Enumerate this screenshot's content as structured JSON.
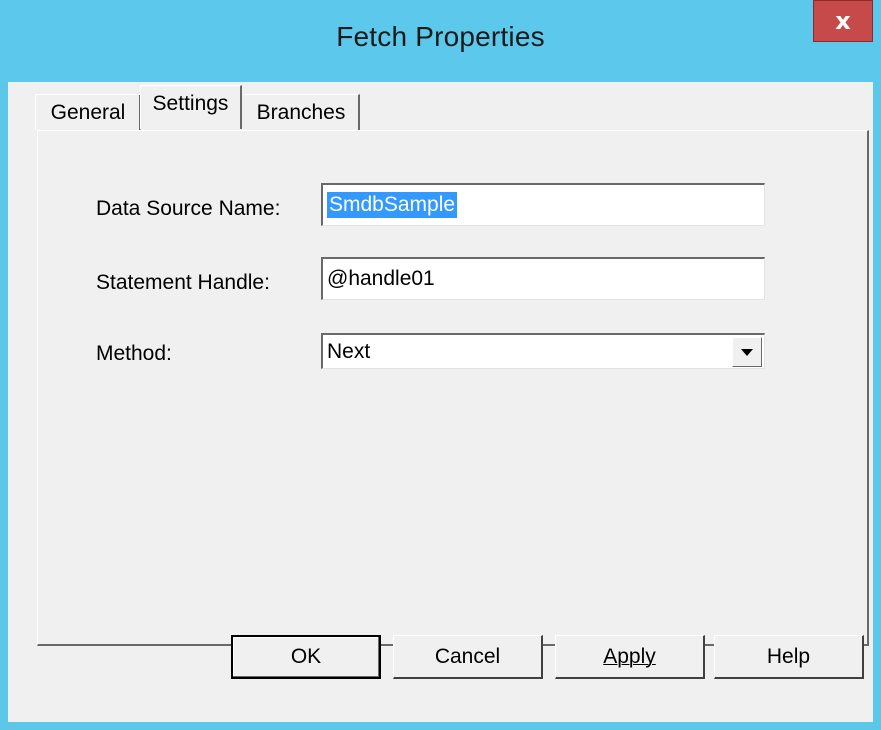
{
  "window": {
    "title": "Fetch Properties",
    "close_label": "x"
  },
  "tabs": [
    {
      "label": "General",
      "active": false
    },
    {
      "label": "Settings",
      "active": true
    },
    {
      "label": "Branches",
      "active": false
    }
  ],
  "form": {
    "data_source_label": "Data Source Name:",
    "data_source_value": "SmdbSample",
    "statement_handle_label": "Statement Handle:",
    "statement_handle_value": "@handle01",
    "method_label": "Method:",
    "method_value": "Next"
  },
  "buttons": {
    "ok": "OK",
    "cancel": "Cancel",
    "apply": "Apply",
    "help": "Help"
  },
  "colors": {
    "titlebar": "#5cc8ec",
    "close_button": "#c74a4a",
    "selection": "#3399ff"
  }
}
